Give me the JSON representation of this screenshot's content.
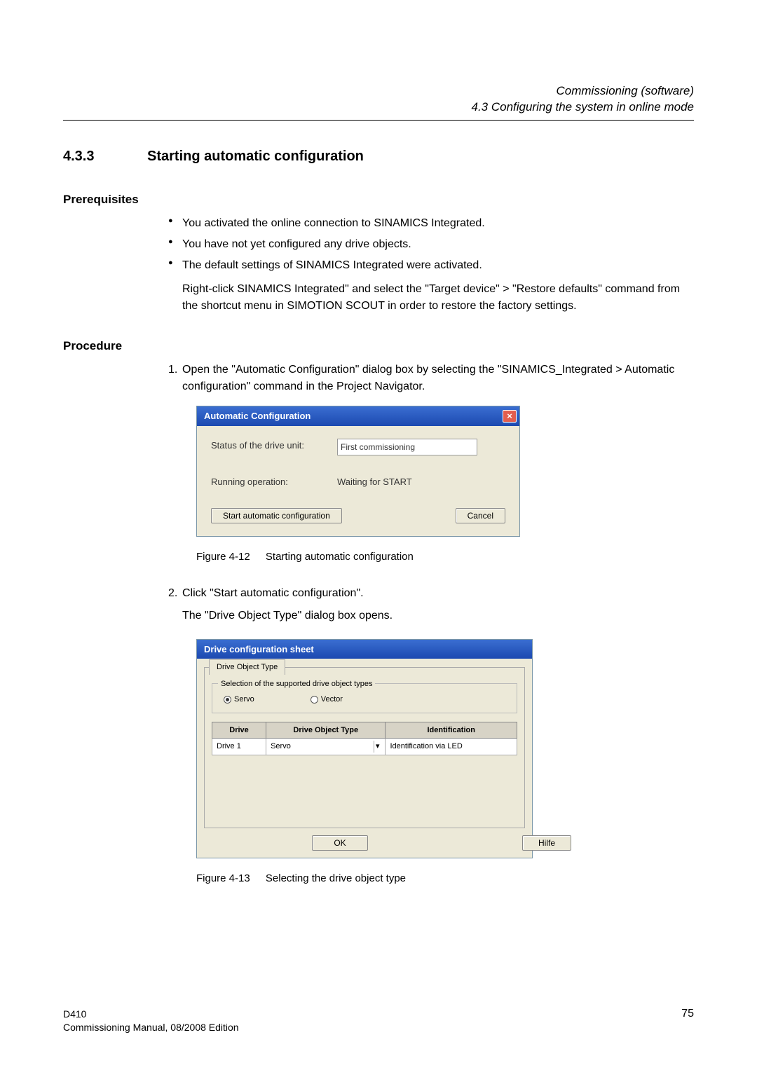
{
  "header": {
    "chapter": "Commissioning (software)",
    "subsection_path": "4.3 Configuring the system in online mode"
  },
  "section": {
    "number": "4.3.3",
    "title": "Starting automatic configuration"
  },
  "prerequisites": {
    "heading": "Prerequisites",
    "items": [
      "You activated the online connection to SINAMICS Integrated.",
      "You have not yet configured any drive objects.",
      "The default settings of SINAMICS Integrated were activated."
    ],
    "note": "Right-click SINAMICS Integrated\" and select the \"Target device\" > \"Restore defaults\" command from the shortcut menu in SIMOTION SCOUT in order to restore the factory settings."
  },
  "procedure": {
    "heading": "Procedure",
    "step1": "Open the \"Automatic Configuration\" dialog box by selecting the \"SINAMICS_Integrated > Automatic configuration\" command in the Project Navigator.",
    "step2": "Click \"Start automatic configuration\".",
    "step2_sub": "The \"Drive Object Type\" dialog box opens."
  },
  "dialog1": {
    "title": "Automatic Configuration",
    "status_label": "Status of the drive unit:",
    "status_value": "First commissioning",
    "running_label": "Running operation:",
    "running_value": "Waiting for START",
    "start_btn": "Start automatic configuration",
    "cancel_btn": "Cancel"
  },
  "figure1": {
    "num": "Figure 4-12",
    "caption": "Starting automatic configuration"
  },
  "dialog2": {
    "title": "Drive configuration sheet",
    "tab": "Drive Object Type",
    "group_title": "Selection of the supported drive object types",
    "radio_servo": "Servo",
    "radio_vector": "Vector",
    "col_drive": "Drive",
    "col_type": "Drive Object Type",
    "col_id": "Identification",
    "row_drive": "Drive 1",
    "row_type": "Servo",
    "row_id": "Identification via LED",
    "ok_btn": "OK",
    "help_btn": "Hilfe"
  },
  "figure2": {
    "num": "Figure 4-13",
    "caption": "Selecting the drive object type"
  },
  "footer": {
    "line1": "D410",
    "line2": "Commissioning Manual, 08/2008 Edition",
    "page": "75"
  },
  "chart_data": null
}
